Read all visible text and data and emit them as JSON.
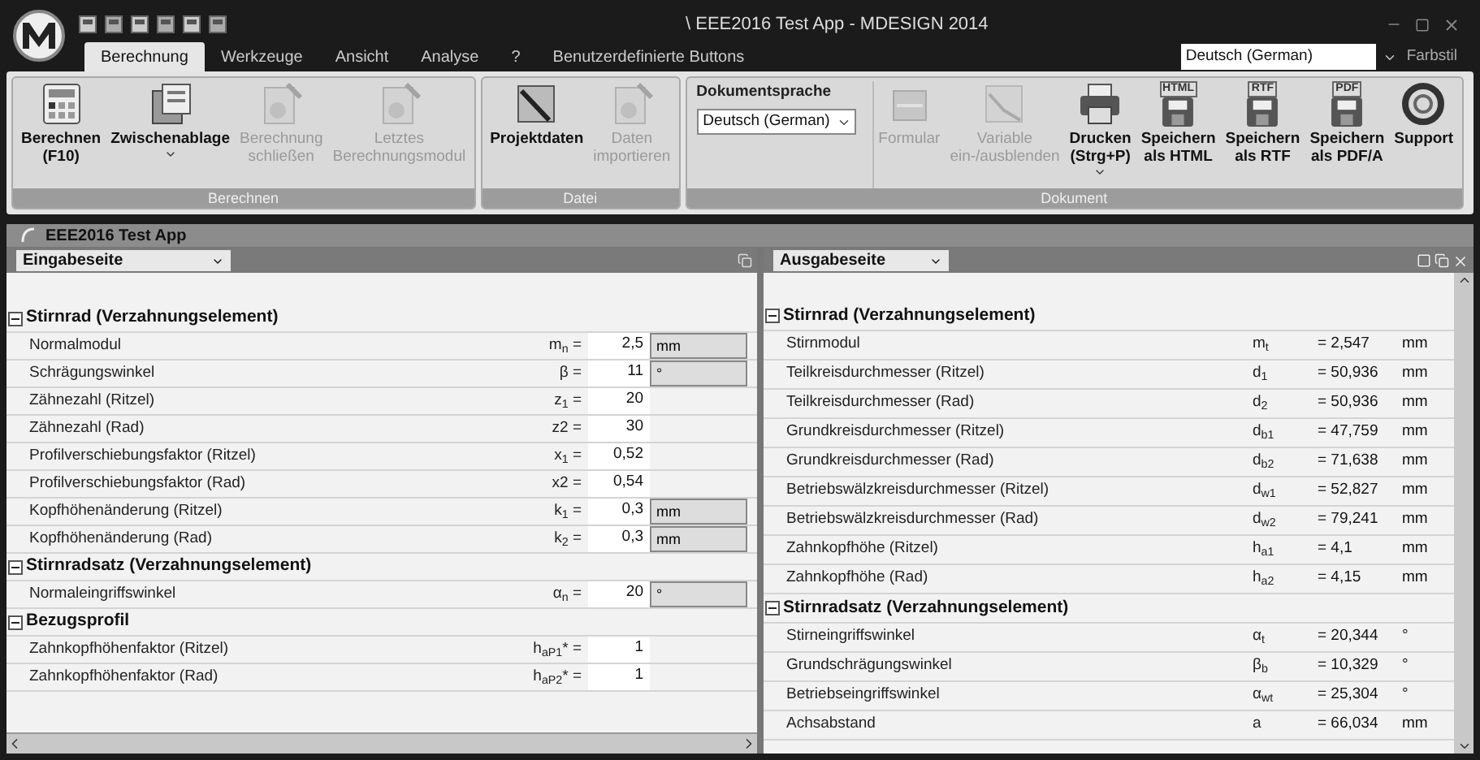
{
  "window": {
    "title": "\\ EEE2016 Test App - MDESIGN 2014"
  },
  "menu_tabs": [
    {
      "label": "Berechnung",
      "selected": true
    },
    {
      "label": "Werkzeuge",
      "selected": false
    },
    {
      "label": "Ansicht",
      "selected": false
    },
    {
      "label": "Analyse",
      "selected": false
    },
    {
      "label": "?",
      "selected": false
    },
    {
      "label": "Benutzerdefinierte Buttons",
      "selected": false
    }
  ],
  "language_select": {
    "value": "Deutsch (German)"
  },
  "color_style": {
    "label": "Farbstil"
  },
  "ribbon_groups": [
    {
      "label": "Berechnen",
      "items": [
        {
          "kind": "button",
          "label": "Berechnen\n(F10)",
          "disabled": false,
          "has_menu": false
        },
        {
          "kind": "button",
          "label": "Zwischenablage",
          "disabled": false,
          "has_menu": true
        },
        {
          "kind": "button",
          "label": "Berechnung\nschließen",
          "disabled": true,
          "has_menu": false
        },
        {
          "kind": "button",
          "label": "Letztes\nBerechnungsmodul",
          "disabled": true,
          "has_menu": false
        }
      ]
    },
    {
      "label": "Datei",
      "items": [
        {
          "kind": "button",
          "label": "Projektdaten",
          "disabled": false,
          "has_menu": false
        },
        {
          "kind": "button",
          "label": "Daten\nimportieren",
          "disabled": true,
          "has_menu": false
        }
      ]
    },
    {
      "label": "Dokument",
      "items": [
        {
          "kind": "select",
          "label": "Dokumentsprache",
          "value": "Deutsch (German)"
        },
        {
          "kind": "button",
          "label": "Formular",
          "disabled": true,
          "has_menu": false
        },
        {
          "kind": "button",
          "label": "Variable\nein-/ausblenden",
          "disabled": true,
          "has_menu": false
        },
        {
          "kind": "button",
          "label": "Drucken\n(Strg+P)",
          "disabled": false,
          "has_menu": true
        },
        {
          "kind": "button",
          "label": "Speichern\nals HTML",
          "disabled": false,
          "has_menu": false,
          "badge": "HTML"
        },
        {
          "kind": "button",
          "label": "Speichern\nals RTF",
          "disabled": false,
          "has_menu": false,
          "badge": "RTF"
        },
        {
          "kind": "button",
          "label": "Speichern\nals PDF/A",
          "disabled": false,
          "has_menu": false,
          "badge": "PDF"
        },
        {
          "kind": "button",
          "label": "Support",
          "disabled": false,
          "has_menu": false
        }
      ]
    }
  ],
  "document": {
    "title": "EEE2016 Test App"
  },
  "input_page": {
    "selector": "Eingabeseite",
    "groups": [
      {
        "title": "Stirnrad (Verzahnungselement)",
        "expanded": true,
        "rows": [
          {
            "label": "Normalmodul",
            "symbol": "m$_{n}$ =",
            "value": "2,5",
            "unit": "mm"
          },
          {
            "label": "Schrägungswinkel",
            "symbol": "β =",
            "value": "11",
            "unit": "°"
          },
          {
            "label": "Zähnezahl (Ritzel)",
            "symbol": "z$_{1}$ =",
            "value": "20"
          },
          {
            "label": "Zähnezahl (Rad)",
            "symbol": "z2 =",
            "value": "30"
          },
          {
            "label": "Profilverschiebungsfaktor (Ritzel)",
            "symbol": "x$_{1}$ =",
            "value": "0,52"
          },
          {
            "label": "Profilverschiebungsfaktor (Rad)",
            "symbol": "x2 =",
            "value": "0,54"
          },
          {
            "label": "Kopfhöhenänderung (Ritzel)",
            "symbol": "k$_{1}$ =",
            "value": "0,3",
            "unit": "mm"
          },
          {
            "label": "Kopfhöhenänderung (Rad)",
            "symbol": "k$_{2}$ =",
            "value": "0,3",
            "unit": "mm"
          }
        ]
      },
      {
        "title": "Stirnradsatz (Verzahnungselement)",
        "expanded": true,
        "rows": [
          {
            "label": "Normaleingriffswinkel",
            "symbol": "α$_{n}$ =",
            "value": "20",
            "unit": "°"
          }
        ]
      },
      {
        "title": "Bezugsprofil",
        "expanded": true,
        "rows": [
          {
            "label": "Zahnkopfhöhenfaktor (Ritzel)",
            "symbol": "h$_{aP1}$* =",
            "value": "1"
          },
          {
            "label": "Zahnkopfhöhenfaktor (Rad)",
            "symbol": "h$_{aP2}$* =",
            "value": "1"
          }
        ]
      }
    ]
  },
  "output_page": {
    "selector": "Ausgabeseite",
    "groups": [
      {
        "title": "Stirnrad (Verzahnungselement)",
        "expanded": true,
        "rows": [
          {
            "label": "Stirnmodul",
            "symbol": "m$_{t}$",
            "value": "= 2,547",
            "unit": "mm"
          },
          {
            "label": "Teilkreisdurchmesser (Ritzel)",
            "symbol": "d$_{1}$",
            "value": "= 50,936",
            "unit": "mm"
          },
          {
            "label": "Teilkreisdurchmesser (Rad)",
            "symbol": "d$_{2}$",
            "value": "= 50,936",
            "unit": "mm"
          },
          {
            "label": "Grundkreisdurchmesser (Ritzel)",
            "symbol": "d$_{b1}$",
            "value": "= 47,759",
            "unit": "mm"
          },
          {
            "label": "Grundkreisdurchmesser (Rad)",
            "symbol": "d$_{b2}$",
            "value": "= 71,638",
            "unit": "mm"
          },
          {
            "label": "Betriebswälzkreisdurchmesser (Ritzel)",
            "symbol": "d$_{w1}$",
            "value": "= 52,827",
            "unit": "mm"
          },
          {
            "label": "Betriebswälzkreisdurchmesser (Rad)",
            "symbol": "d$_{w2}$",
            "value": "= 79,241",
            "unit": "mm"
          },
          {
            "label": "Zahnkopfhöhe (Ritzel)",
            "symbol": "h$_{a1}$",
            "value": "= 4,1",
            "unit": "mm"
          },
          {
            "label": "Zahnkopfhöhe (Rad)",
            "symbol": "h$_{a2}$",
            "value": "= 4,15",
            "unit": "mm"
          }
        ]
      },
      {
        "title": "Stirnradsatz (Verzahnungselement)",
        "expanded": true,
        "rows": [
          {
            "label": "Stirneingriffswinkel",
            "symbol": "α$_{t}$",
            "value": "= 20,344",
            "unit": "°"
          },
          {
            "label": "Grundschrägungswinkel",
            "symbol": "β$_{b}$",
            "value": "= 10,329",
            "unit": "°"
          },
          {
            "label": "Betriebseingriffswinkel",
            "symbol": "α$_{wt}$",
            "value": "= 25,304",
            "unit": "°"
          },
          {
            "label": "Achsabstand",
            "symbol": "a",
            "value": "= 66,034",
            "unit": "mm"
          }
        ]
      }
    ]
  }
}
